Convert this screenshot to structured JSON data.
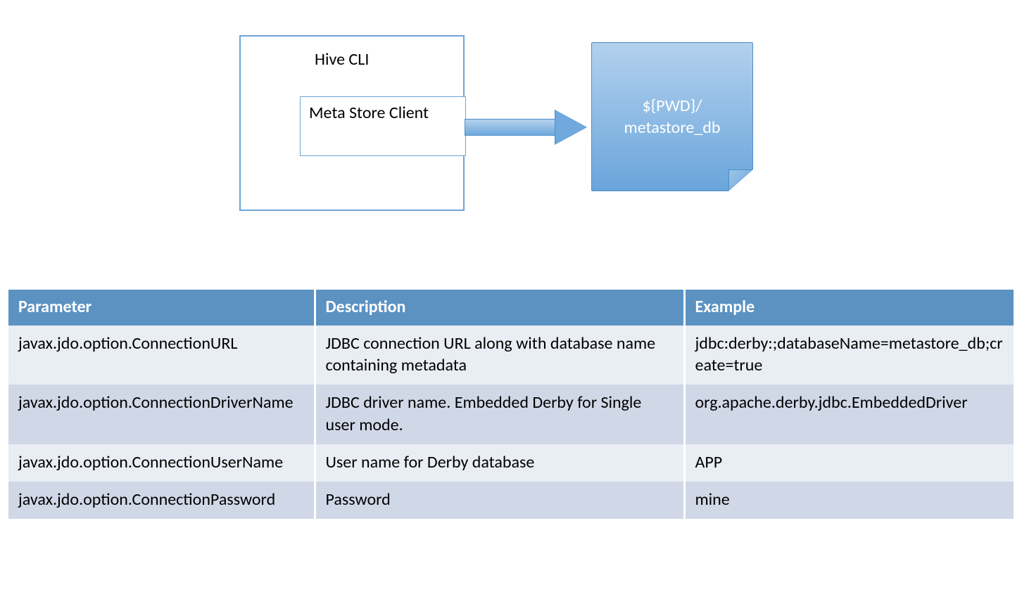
{
  "diagram": {
    "hive_title": "Hive CLI",
    "metastore_client": "Meta Store Client",
    "db_line1": "${PWD}/",
    "db_line2": "metastore_db"
  },
  "table": {
    "headers": {
      "param": "Parameter",
      "desc": "Description",
      "example": "Example"
    },
    "rows": [
      {
        "param": "javax.jdo.option.ConnectionURL",
        "desc": "JDBC connection URL along with database name containing metadata",
        "example": "jdbc:derby:;databaseName=metastore_db;create=true"
      },
      {
        "param": "javax.jdo.option.ConnectionDriverName",
        "desc": "JDBC driver name. Embedded Derby for Single user mode.",
        "example": "org.apache.derby.jdbc.EmbeddedDriver"
      },
      {
        "param": "javax.jdo.option.ConnectionUserName",
        "desc": "User name for Derby database",
        "example": "APP"
      },
      {
        "param": "javax.jdo.option.ConnectionPassword",
        "desc": "Password",
        "example": "mine"
      }
    ]
  }
}
